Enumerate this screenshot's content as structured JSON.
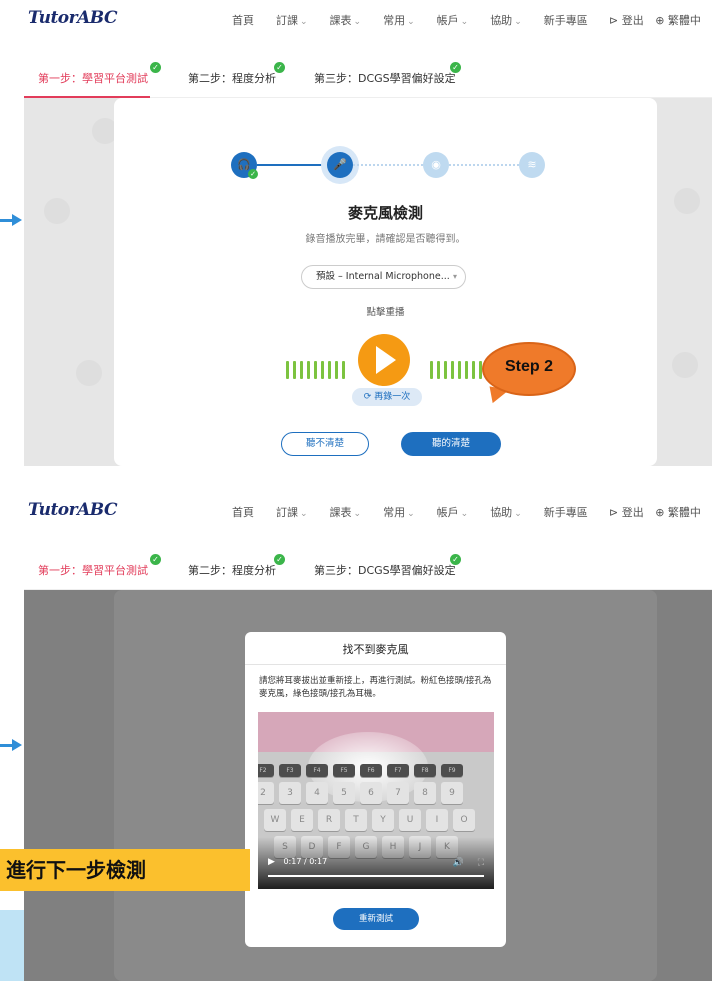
{
  "brand": "TutorABC",
  "nav": {
    "items": [
      {
        "label": "首頁",
        "dropdown": false
      },
      {
        "label": "訂課",
        "dropdown": true
      },
      {
        "label": "課表",
        "dropdown": true
      },
      {
        "label": "常用",
        "dropdown": true
      },
      {
        "label": "帳戶",
        "dropdown": true
      },
      {
        "label": "協助",
        "dropdown": true
      },
      {
        "label": "新手專區",
        "dropdown": false
      }
    ],
    "chevron": "⌄",
    "logout": "⊳ 登出",
    "language": "⊕ 繁體中"
  },
  "steps": [
    {
      "label": "第一步：學習平台測試",
      "done": true,
      "active": true
    },
    {
      "label": "第二步：程度分析",
      "done": true,
      "active": false
    },
    {
      "label": "第三步：DCGS學習偏好設定",
      "done": true,
      "active": false
    }
  ],
  "mic_test": {
    "title": "麥克風檢測",
    "subtitle": "錄音播放完畢，請確認是否聽得到。",
    "device": "預設 – Internal Microphone...",
    "device_arrow": "▾",
    "replay_label": "點擊重播",
    "rerecord": "⟳ 再錄一次",
    "cant_hear": "聽不清楚",
    "can_hear": "聽的清楚"
  },
  "callout": "Step 2",
  "modal": {
    "title": "找不到麥克風",
    "message": "請您將耳麥拔出並重新接上，再進行測試。粉紅色接頭/接孔為麥克風，綠色接頭/接孔為耳機。",
    "video_time": "0:17 / 0:17",
    "play_glyph": "▶",
    "volume_glyph": "🔊",
    "fullscreen_glyph": "⛶",
    "retry": "重新測試",
    "keys": {
      "fn": [
        "F2",
        "F3",
        "F4",
        "F5",
        "F6",
        "F7",
        "F8",
        "F9"
      ],
      "num": [
        "2",
        "3",
        "4",
        "5",
        "6",
        "7",
        "8",
        "9"
      ],
      "alpha1": [
        "W",
        "E",
        "R",
        "T",
        "Y",
        "U",
        "I",
        "O"
      ],
      "alpha2": [
        "S",
        "D",
        "F",
        "G",
        "H",
        "J",
        "K"
      ]
    }
  },
  "banner": "進行下一步檢測",
  "colors": {
    "primary": "#1e6fbf",
    "accent": "#e23c5a",
    "play": "#f59a13",
    "callout": "#ef7a2a",
    "banner": "#fbc02d"
  }
}
